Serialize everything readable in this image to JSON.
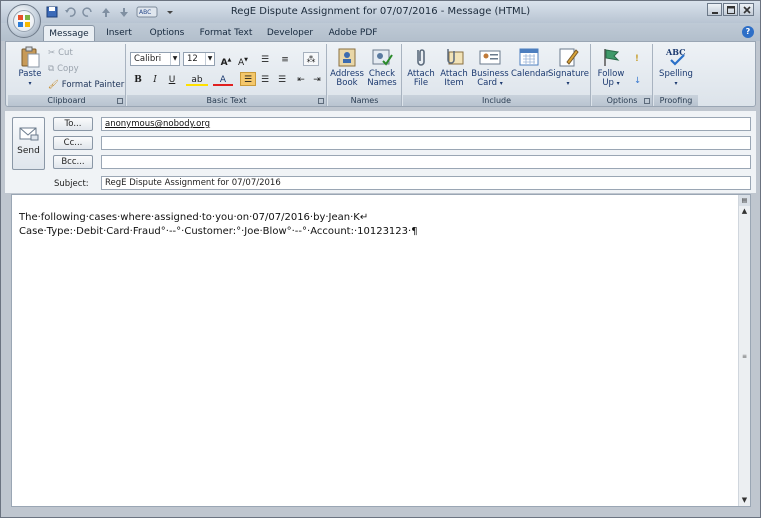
{
  "window": {
    "title": "RegE Dispute Assignment for 07/07/2016 - Message (HTML)"
  },
  "tabs": [
    "Message",
    "Insert",
    "Options",
    "Format Text",
    "Developer",
    "Adobe PDF"
  ],
  "ribbon": {
    "clipboard": {
      "label": "Clipboard",
      "paste": "Paste",
      "cut": "Cut",
      "copy": "Copy",
      "format_painter": "Format Painter"
    },
    "basic_text": {
      "label": "Basic Text",
      "font": "Calibri",
      "size": "12"
    },
    "names": {
      "label": "Names",
      "address_book": [
        "Address",
        "Book"
      ],
      "check_names": [
        "Check",
        "Names"
      ]
    },
    "include": {
      "label": "Include",
      "attach_file": [
        "Attach",
        "File"
      ],
      "attach_item": [
        "Attach",
        "Item"
      ],
      "business_card": [
        "Business",
        "Card"
      ],
      "calendar": "Calendar",
      "signature": "Signature"
    },
    "options": {
      "label": "Options",
      "follow_up": [
        "Follow",
        "Up"
      ]
    },
    "proofing": {
      "label": "Proofing",
      "spelling": "Spelling"
    }
  },
  "header": {
    "send": "Send",
    "to_btn": "To...",
    "cc_btn": "Cc...",
    "bcc_btn": "Bcc...",
    "subject_label": "Subject:",
    "to_value": "anonymous@nobody.org",
    "cc_value": "",
    "bcc_value": "",
    "subject_value": "RegE Dispute Assignment for 07/07/2016"
  },
  "body": {
    "line1": "The·following·cases·where·assigned·to·you·on·07/07/2016·by·Jean·K↵",
    "line2": "Case·Type:·Debit·Card·Fraud°·--°·Customer:°·Joe·Blow°·--°·Account:·10123123·¶"
  }
}
